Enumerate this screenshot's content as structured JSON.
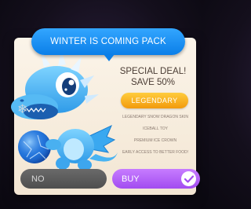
{
  "popup": {
    "title": "WINTER IS COMING PACK",
    "deal_line1": "SPECIAL DEAL!",
    "deal_line2": "SAVE 50%",
    "rarity": "LEGENDARY",
    "features": [
      "LEGENDARY SNOW DRAGON SKIN",
      "ICEBALL TOY",
      "PREMIUM ICE CROWN",
      "EARLY ACCESS TO BETTER FOOD!"
    ],
    "no_label": "NO",
    "buy_label": "BUY"
  },
  "icons": {
    "snowflake": "snowflake-icon",
    "checkmark": "checkmark-icon",
    "dragon": "snow-dragon"
  },
  "colors": {
    "title_blue": "#0a7ee8",
    "rarity_orange": "#f29a0c",
    "buy_purple": "#a24cf0",
    "no_gray": "#555555",
    "card_cream": "#f6ebdb"
  }
}
